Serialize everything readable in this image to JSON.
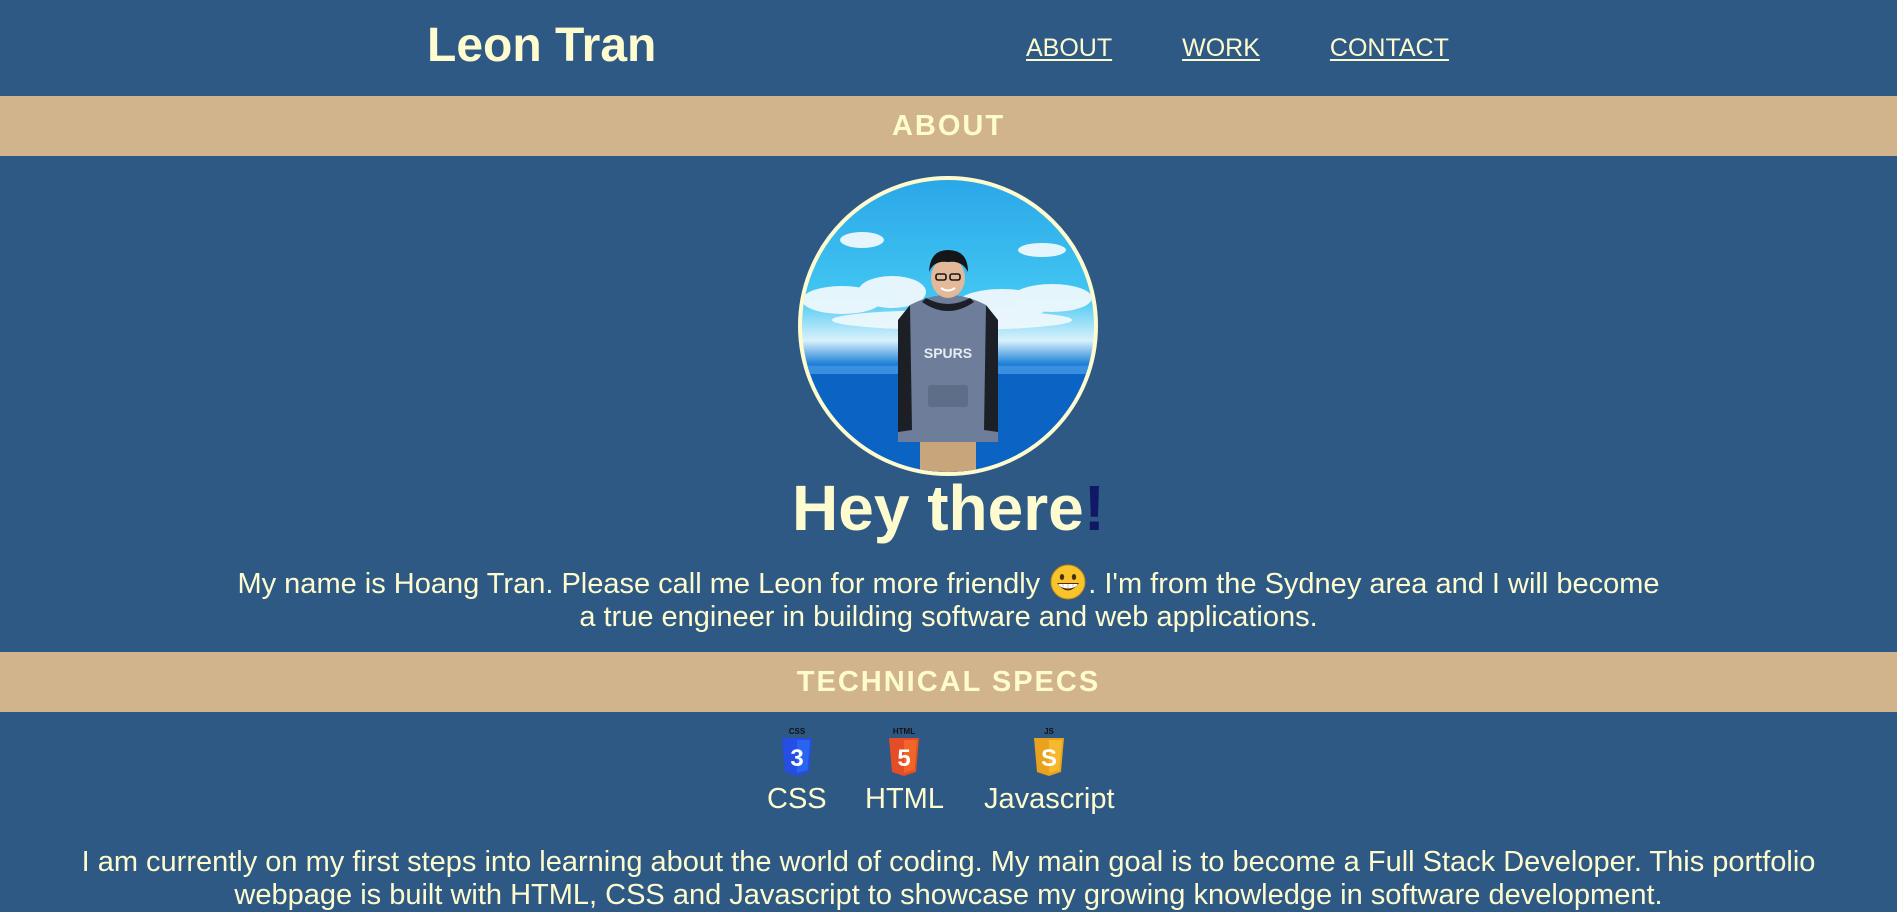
{
  "header": {
    "brand": "Leon Tran",
    "nav": [
      {
        "label": "ABOUT"
      },
      {
        "label": "WORK"
      },
      {
        "label": "CONTACT"
      }
    ]
  },
  "about": {
    "section_title": "ABOUT",
    "greeting": "Hey there",
    "greeting_mark": "!",
    "intro_before_emoji": "My name is Hoang Tran. Please call me Leon for more friendly ",
    "intro_after_emoji": ". I'm from the Sydney area and I will become a true engineer in building software and web applications.",
    "emoji_icon": "grinning-face-icon"
  },
  "tech": {
    "section_title": "TECHNICAL SPECS",
    "items": [
      {
        "label": "CSS",
        "badge": "CSS",
        "glyph": "3",
        "icon": "css3-icon",
        "color": "#264de4"
      },
      {
        "label": "HTML",
        "badge": "HTML",
        "glyph": "5",
        "icon": "html5-icon",
        "color": "#e44d26"
      },
      {
        "label": "Javascript",
        "badge": "JS",
        "glyph": "S",
        "icon": "javascript-icon",
        "color": "#e8a21d"
      }
    ],
    "description": "I am currently on my first steps into learning about the world of coding. My main goal is to become a Full Stack Developer. This portfolio webpage is built with HTML, CSS and Javascript to showcase my growing knowledge in software development."
  },
  "colors": {
    "background": "#2e5984",
    "bar": "#d1b48c",
    "text": "#fefccf",
    "accent": "#111866"
  }
}
